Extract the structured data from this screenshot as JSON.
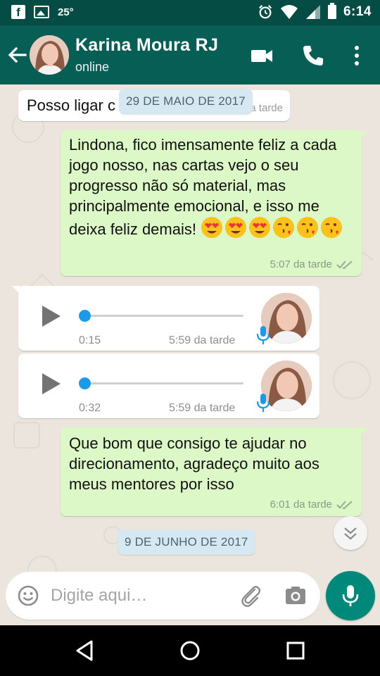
{
  "status_bar": {
    "temperature": "25°",
    "time": "6:14",
    "icons": [
      "facebook-icon",
      "image-icon",
      "alarm-icon",
      "wifi-icon",
      "signal-icon",
      "battery-icon"
    ]
  },
  "app_bar": {
    "contact_name": "Karina Moura RJ",
    "contact_status": "online",
    "icons": [
      "back-arrow-icon",
      "video-call-icon",
      "phone-icon",
      "more-vert-icon"
    ]
  },
  "messages": [
    {
      "direction": "in",
      "text": "Posso ligar c",
      "time": "da tarde"
    },
    {
      "type": "date",
      "label": "29 DE MAIO DE 2017"
    },
    {
      "direction": "out",
      "text": "Lindona, fico imensamente feliz a cada jogo nosso, nas cartas vejo o seu progresso não só material, mas principalmente emocional, e isso me deixa feliz demais!",
      "emojis": [
        "heart-eyes",
        "heart-eyes",
        "heart-eyes",
        "kiss",
        "kiss",
        "kiss"
      ],
      "time": "5:07 da tarde",
      "status": "read"
    },
    {
      "direction": "in",
      "type": "voice",
      "duration": "0:15",
      "time": "5:59 da tarde",
      "progress": 0
    },
    {
      "direction": "in",
      "type": "voice",
      "duration": "0:32",
      "time": "5:59 da tarde",
      "progress": 0
    },
    {
      "direction": "out",
      "text": "Que bom que consigo te ajudar no direcionamento, agradeço muito aos meus mentores por isso",
      "time": "6:01 da tarde",
      "status": "read"
    },
    {
      "type": "date",
      "label": "9 DE JUNHO DE 2017"
    }
  ],
  "composer": {
    "placeholder": "Digite aqui…"
  },
  "colors": {
    "status_bar": "#054d44",
    "app_bar": "#075e54",
    "bubble_out": "#dcf8c6",
    "bubble_in": "#ffffff",
    "date_chip": "#d6e9f3",
    "mic_button": "#00897b",
    "voice_progress": "#1a9be8",
    "chat_background": "#ece5dd"
  }
}
